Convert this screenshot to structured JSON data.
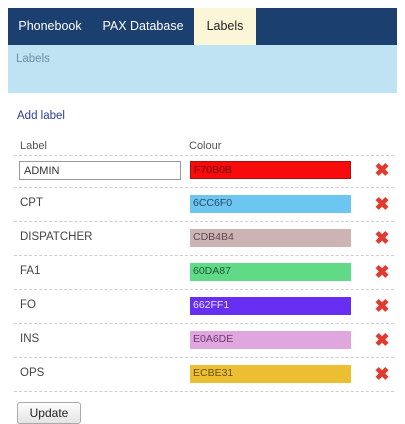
{
  "tabs": [
    {
      "label": "Phonebook"
    },
    {
      "label": "PAX Database"
    },
    {
      "label": "Labels"
    }
  ],
  "banner": {
    "title": "Labels"
  },
  "add_label": "Add label",
  "columns": {
    "label": "Label",
    "colour": "Colour"
  },
  "rows": [
    {
      "label": "ADMIN",
      "colour_hex": "F70B0B",
      "color": "#F70B0B",
      "text_color": "#6a0000"
    },
    {
      "label": "CPT",
      "colour_hex": "6CC6F0",
      "color": "#6CC6F0",
      "text_color": "#2b4a6a"
    },
    {
      "label": "DISPATCHER",
      "colour_hex": "CDB4B4",
      "color": "#CDB4B4",
      "text_color": "#5b4a4a"
    },
    {
      "label": "FA1",
      "colour_hex": "60DA87",
      "color": "#60DA87",
      "text_color": "#1f5a35"
    },
    {
      "label": "FO",
      "colour_hex": "662FF1",
      "color": "#662FF1",
      "text_color": "#e8e2ff"
    },
    {
      "label": "INS",
      "colour_hex": "E0A6DE",
      "color": "#E0A6DE",
      "text_color": "#6a3a68"
    },
    {
      "label": "OPS",
      "colour_hex": "ECBE31",
      "color": "#ECBE31",
      "text_color": "#6a5010"
    }
  ],
  "delete_icon": "close-icon",
  "update_button": "Update"
}
